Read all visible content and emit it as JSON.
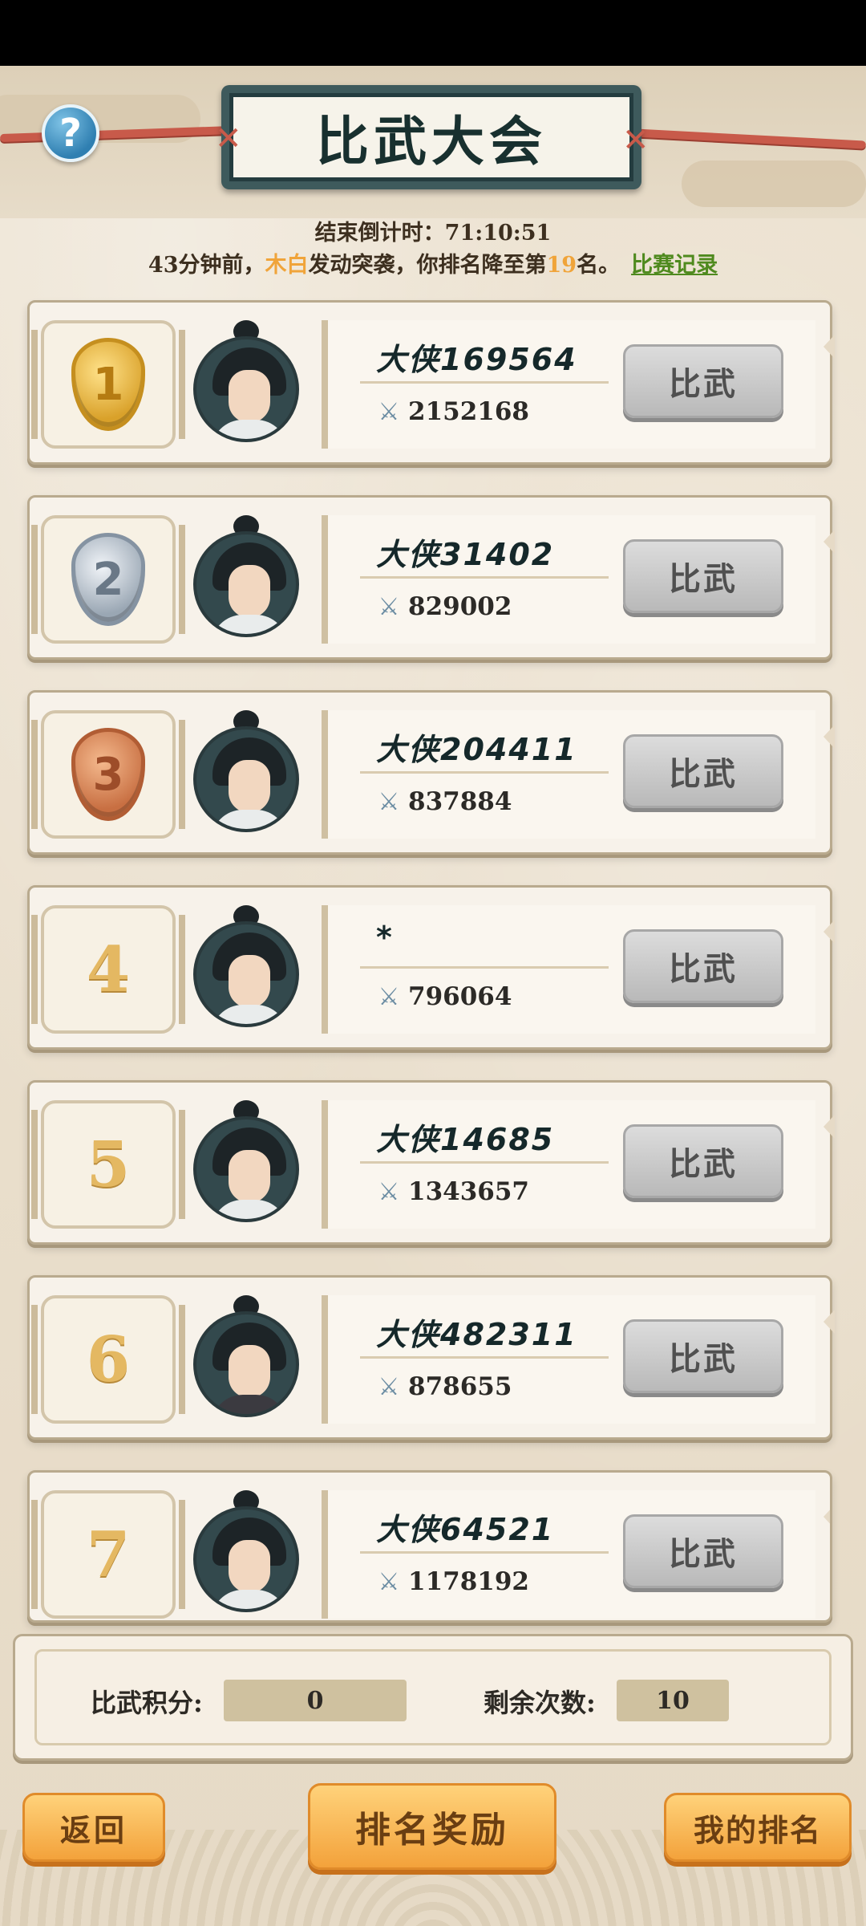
{
  "header": {
    "title": "比武大会",
    "help_icon": "?"
  },
  "countdown": {
    "label": "结束倒计时：",
    "time": "71:10:51"
  },
  "notice": {
    "part1": "43分钟前，",
    "attacker": "木白",
    "part2": "发动突袭，你排名降至第",
    "rank": "19",
    "part3": "名。",
    "record_link": "比赛记录"
  },
  "ranking": [
    {
      "rank": "1",
      "name": "大侠169564",
      "power": "2152168",
      "button": "比武"
    },
    {
      "rank": "2",
      "name": "大侠31402",
      "power": "829002",
      "button": "比武"
    },
    {
      "rank": "3",
      "name": "大侠204411",
      "power": "837884",
      "button": "比武"
    },
    {
      "rank": "4",
      "name": "*",
      "power": "796064",
      "button": "比武"
    },
    {
      "rank": "5",
      "name": "大侠14685",
      "power": "1343657",
      "button": "比武"
    },
    {
      "rank": "6",
      "name": "大侠482311",
      "power": "878655",
      "button": "比武"
    },
    {
      "rank": "7",
      "name": "大侠64521",
      "power": "1178192",
      "button": "比武"
    }
  ],
  "score": {
    "points_label": "比武积分:",
    "points_value": "0",
    "remaining_label": "剩余次数:",
    "remaining_value": "10"
  },
  "footer": {
    "back": "返回",
    "reward": "排名奖励",
    "my_rank": "我的排名"
  },
  "icons": {
    "power": "swords-icon",
    "help": "help-icon"
  },
  "colors": {
    "highlight": "#f0a43a",
    "link": "#4f8a1e",
    "button_orange": "#f3a23b"
  }
}
